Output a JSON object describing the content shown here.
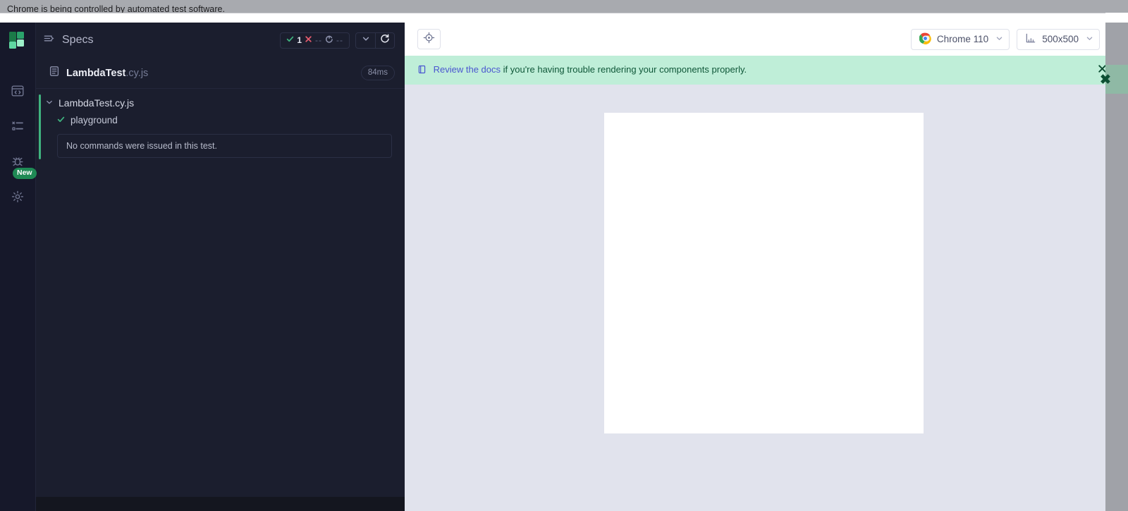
{
  "automation_notice": {
    "message": "Chrome is being controlled by automated test software."
  },
  "colors": {
    "app_background": "#1b1e2e",
    "rail_background": "#16182a",
    "accent_green": "#3fb37f",
    "banner_background": "#bfeed8",
    "banner_text": "#0f5738",
    "banner_link": "#4a56d0",
    "aut_background": "#e1e3ed",
    "fail_red": "#e45c6e",
    "badge_green": "#1f8a55"
  },
  "rail": {
    "logo_name": "cypress-logo",
    "items": [
      {
        "icon": "specs-browser-code-icon",
        "name": "sidebar-item-specs",
        "badge": ""
      },
      {
        "icon": "runs-list-icon",
        "name": "sidebar-item-runs",
        "badge": ""
      },
      {
        "icon": "debug-bug-icon",
        "name": "sidebar-item-debug",
        "badge": "New"
      },
      {
        "icon": "settings-gear-icon",
        "name": "sidebar-item-settings",
        "badge": ""
      }
    ]
  },
  "reporter": {
    "header": {
      "panel_icon": "collapse-panel-icon",
      "title": "Specs",
      "stats": [
        {
          "icon": "check-icon",
          "label": "passed",
          "value": "1",
          "dim": false
        },
        {
          "icon": "x-icon",
          "label": "failed",
          "value": "--",
          "dim": true
        },
        {
          "icon": "pending-icon",
          "label": "pending",
          "value": "--",
          "dim": true
        }
      ],
      "controls": [
        {
          "icon": "chevron-down-icon",
          "name": "stats-toggle-button"
        },
        {
          "icon": "restart-icon",
          "name": "restart-tests-button"
        }
      ]
    },
    "spec_file": {
      "icon": "spec-file-icon",
      "name": "LambdaTest",
      "extension": ".cy.js",
      "duration": "84ms"
    },
    "suite": {
      "chevron": "chevron-down-icon",
      "title": "LambdaTest.cy.js",
      "tests": [
        {
          "status_icon": "check-icon",
          "title": "playground",
          "message": "No commands were issued in this test."
        }
      ]
    }
  },
  "aut": {
    "toolbar": {
      "playground_button": {
        "icon": "selector-playground-crosshair-icon",
        "name": "selector-playground-button"
      },
      "browser_select": {
        "icon": "chrome-logo-icon",
        "label": "Chrome 110",
        "caret": "chevron-down-icon"
      },
      "viewport_select": {
        "icon": "ruler-icon",
        "label": "500x500",
        "caret": "chevron-down-icon"
      }
    },
    "banner": {
      "icon": "docs-book-icon",
      "link_text": "Review the docs",
      "rest_text": " if you're having trouble rendering your components properly.",
      "close_icon": "close-x-icon"
    },
    "preview": {
      "name": "component-preview-frame",
      "content": ""
    }
  }
}
